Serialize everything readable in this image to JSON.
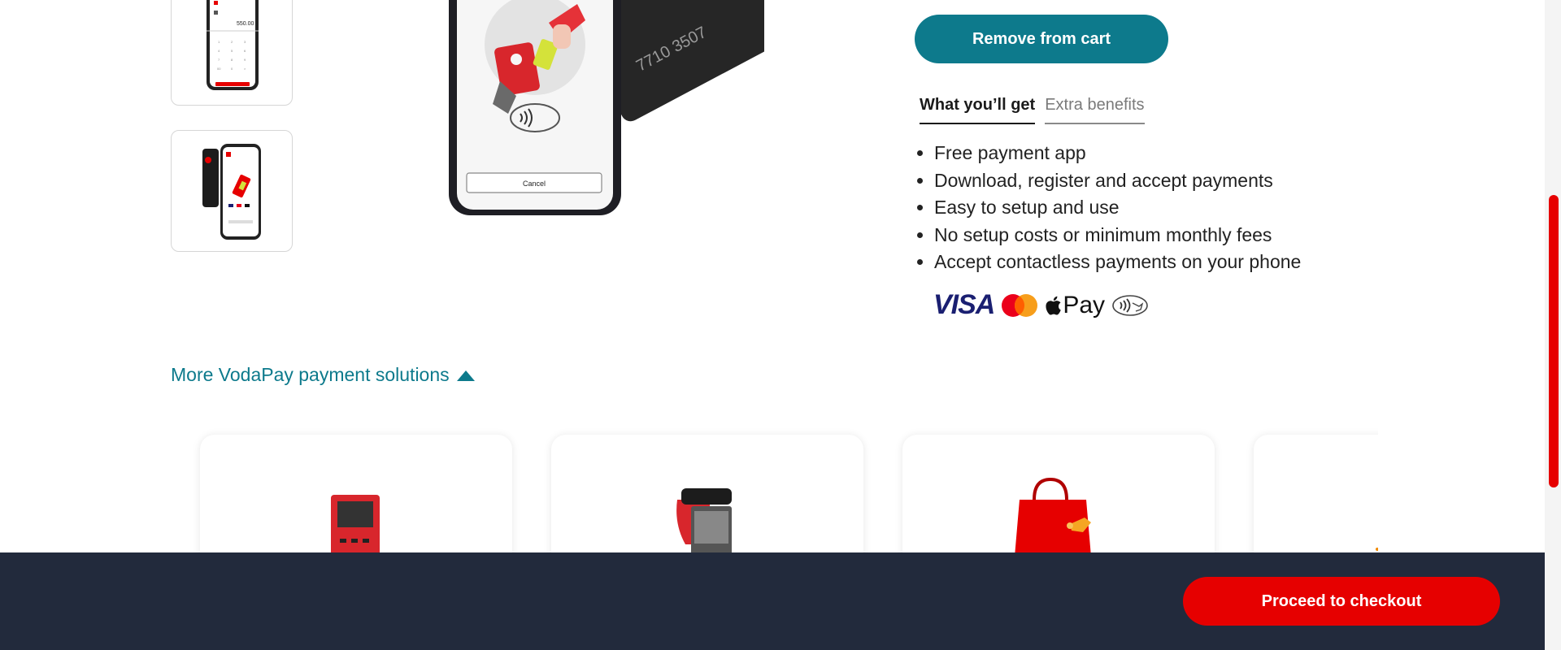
{
  "product": {
    "remove_label": "Remove from cart",
    "tabs": [
      {
        "label": "What you’ll get",
        "active": true
      },
      {
        "label": "Extra benefits",
        "active": false
      }
    ],
    "benefits": [
      "Free payment app",
      "Download, register and accept payments",
      "Easy to setup and use",
      "No setup costs or minimum monthly fees",
      "Accept contactless payments on your phone"
    ],
    "payment_methods": {
      "visa": "VISA",
      "applepay": "Pay",
      "icons": [
        "visa-logo",
        "mastercard-logo",
        "apple-pay-logo",
        "contactless-icon"
      ]
    },
    "hero": {
      "card_number_fragment": "7710 3507",
      "cancel_label": "Cancel"
    },
    "thumb_amount": "550.00"
  },
  "more_solutions": {
    "label": "More VodaPay payment solutions",
    "icon": "caret-up-icon"
  },
  "footer": {
    "checkout_label": "Proceed to checkout"
  },
  "colors": {
    "teal": "#0d7a8c",
    "red": "#e60000",
    "footer_bg": "#222a3c"
  }
}
